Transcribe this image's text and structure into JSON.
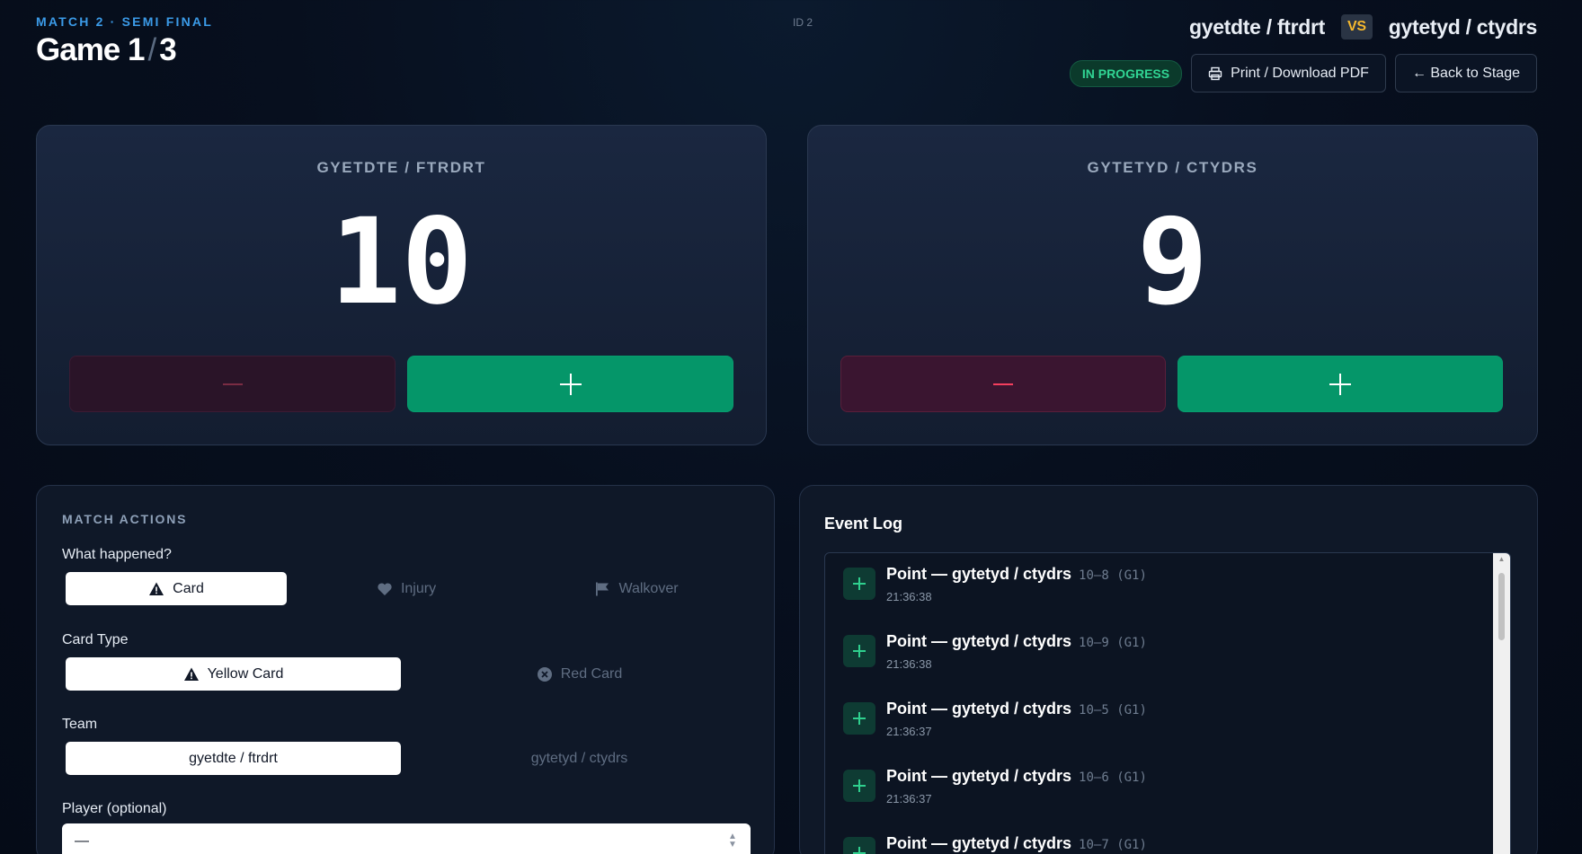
{
  "header": {
    "eyebrow": "MATCH 2 · SEMI FINAL",
    "game_label": "Game",
    "game_current": "1",
    "game_separator": "/",
    "game_total": "3",
    "match_id": "ID 2",
    "team_a": "gyetdte / ftrdrt",
    "vs": "VS",
    "team_b": "gytetyd / ctydrs",
    "status": "IN PROGRESS",
    "print_label": "Print / Download PDF",
    "back_label": "← Back to Stage"
  },
  "scoreboard": {
    "left": {
      "team": "GYETDTE / FTRDRT",
      "score": "10"
    },
    "right": {
      "team": "GYTETYD / CTYDRS",
      "score": "9"
    }
  },
  "match_actions": {
    "title": "MATCH ACTIONS",
    "what_happened_label": "What happened?",
    "what_options": [
      {
        "label": "Card",
        "icon": "warning-icon"
      },
      {
        "label": "Injury",
        "icon": "heart-icon"
      },
      {
        "label": "Walkover",
        "icon": "flag-icon"
      }
    ],
    "card_type_label": "Card Type",
    "card_options": [
      {
        "label": "Yellow Card",
        "icon": "warning-icon"
      },
      {
        "label": "Red Card",
        "icon": "x-circle-icon"
      }
    ],
    "team_label": "Team",
    "team_options": [
      "gyetdte / ftrdrt",
      "gytetyd / ctydrs"
    ],
    "player_label": "Player (optional)",
    "player_value": "—"
  },
  "event_log": {
    "title": "Event Log",
    "events": [
      {
        "text": "Point — gytetyd / ctydrs",
        "score": "10–8 (G1)",
        "time": "21:36:38"
      },
      {
        "text": "Point — gytetyd / ctydrs",
        "score": "10–9 (G1)",
        "time": "21:36:38"
      },
      {
        "text": "Point — gytetyd / ctydrs",
        "score": "10–5 (G1)",
        "time": "21:36:37"
      },
      {
        "text": "Point — gytetyd / ctydrs",
        "score": "10–6 (G1)",
        "time": "21:36:37"
      },
      {
        "text": "Point — gytetyd / ctydrs",
        "score": "10–7 (G1)",
        "time": ""
      }
    ]
  },
  "colors": {
    "accent_blue": "#3b9be8",
    "plus_green": "#059669",
    "minus_red": "#f43f5e",
    "status_green": "#31d594",
    "vs_amber": "#f5b82e"
  }
}
